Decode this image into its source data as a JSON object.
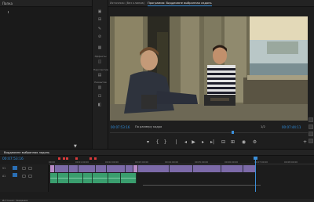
{
  "left_panel": {
    "title": "Папка"
  },
  "effects_strip": {
    "labels": [
      "Эффекты",
      "Перспектива",
      "Размытие"
    ]
  },
  "monitor": {
    "tabs": [
      {
        "label": "Источник: (без клипов)",
        "active": false
      },
      {
        "label": "Программа: Виддеомне выбранная ладонь",
        "active": true
      }
    ],
    "timecode_current": "00:07:53:16",
    "fit": "По размеру кадра",
    "ratio": "1/2",
    "timecode_duration": "00:07:44:11",
    "transport_icons": [
      "marker-icon",
      "in-point-icon",
      "out-point-icon",
      "go-to-in-icon",
      "step-back-icon",
      "play-icon",
      "step-forward-icon",
      "go-to-out-icon",
      "insert-icon",
      "overwrite-icon",
      "export-frame-icon",
      "settings-icon"
    ]
  },
  "timeline": {
    "tab": "Виддеомне выбранная ладонь",
    "timecode": "00:07:53:16",
    "ruler_labels": [
      "00:00",
      "00:01:00:00",
      "00:02:00:00",
      "00:03:00:00",
      "00:04:00:00",
      "00:05:00:00",
      "00:06:00:00",
      "00:07:00:00",
      "00:08:00:00"
    ],
    "tracks": [
      {
        "name": "V1"
      },
      {
        "name": "A1"
      }
    ]
  },
  "footer": {
    "label": "Источник: Сведения"
  },
  "colors": {
    "accent": "#2f8fe0",
    "video_clip": "#7c6aa8",
    "audio_clip": "#3a9e6e"
  }
}
